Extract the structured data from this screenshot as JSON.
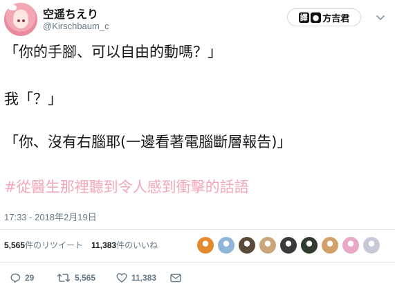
{
  "tweet": {
    "display_name": "空遥ちえり",
    "handle": "@Kirschbaum_c",
    "watermark": {
      "box": "譯",
      "text": "方吉君"
    },
    "lines": [
      "「你的手腳、可以自由的動嗎？」",
      "我「？」",
      "「你、沒有右腦耶(一邊看著電腦斷層報告)」"
    ],
    "hashtag": "#從醫生那裡聽到令人感到衝擊的話語",
    "timestamp": "17:33 - 2018年2月19日"
  },
  "stats": {
    "retweets_count": "5,565",
    "retweets_label": "件のリツイート",
    "likes_count": "11,383",
    "likes_label": "件のいいね"
  },
  "likers": {
    "colors": [
      "#e58a2b",
      "#8fb6d8",
      "#5a4a3a",
      "#c9a77a",
      "#3a3a3a",
      "#2f3b2f",
      "#d4a06a",
      "#e9a9c6",
      "#c7c9d6"
    ]
  },
  "actions": {
    "reply_count": "29",
    "retweet_count": "5,565",
    "like_count": "11,383"
  },
  "colors": {
    "hashtag": "#f3a7b8",
    "secondary_text": "#657786",
    "divider": "#e1e8ed"
  }
}
